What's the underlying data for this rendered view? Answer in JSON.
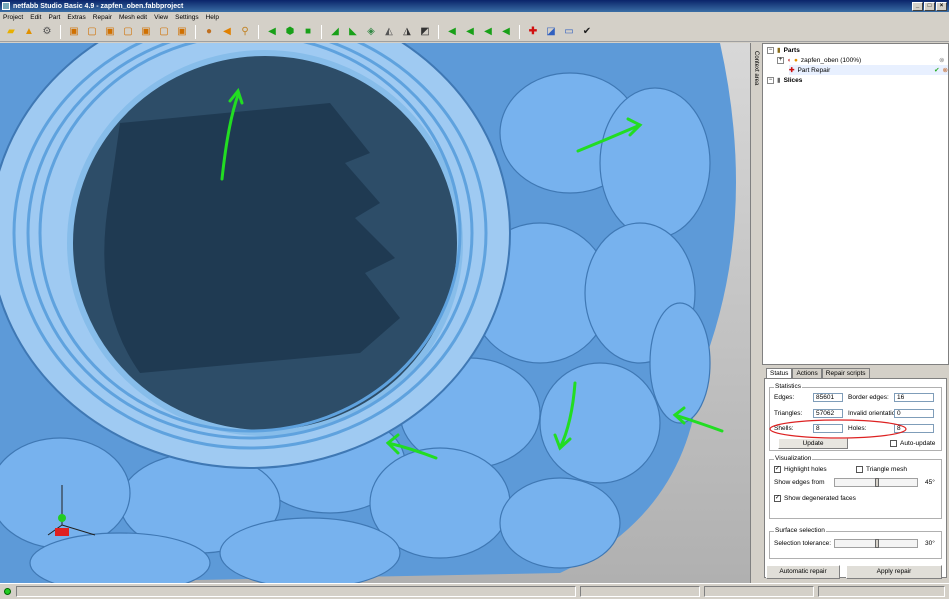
{
  "window": {
    "title": "netfabb Studio Basic 4.9 - zapfen_oben.fabbproject"
  },
  "menu": [
    "Project",
    "Edit",
    "Part",
    "Extras",
    "Repair",
    "Mesh edit",
    "View",
    "Settings",
    "Help"
  ],
  "side_tab": {
    "label": "Context area"
  },
  "tree": {
    "parts_label": "Parts",
    "part_name": "zapfen_oben (100%)",
    "repair_label": "Part Repair",
    "slices_label": "Slices"
  },
  "tabs": [
    "Status",
    "Actions",
    "Repair scripts"
  ],
  "statistics": {
    "title": "Statistics",
    "edges_label": "Edges:",
    "edges_value": "85601",
    "border_edges_label": "Border edges:",
    "border_edges_value": "16",
    "triangles_label": "Triangles:",
    "triangles_value": "57062",
    "invalid_orientation_label": "Invalid orientation:",
    "invalid_orientation_value": "0",
    "shells_label": "Shells:",
    "shells_value": "8",
    "holes_label": "Holes:",
    "holes_value": "8",
    "update_label": "Update",
    "auto_update_label": "Auto-update"
  },
  "visualization": {
    "title": "Visualization",
    "highlight_holes_label": "Highlight holes",
    "highlight_holes_checked": true,
    "triangle_mesh_label": "Triangle mesh",
    "triangle_mesh_checked": false,
    "show_edges_label": "Show edges from",
    "show_edges_value": "45°",
    "show_edges_level": 0.5,
    "show_degenerated_label": "Show degenerated faces",
    "show_degenerated_checked": true
  },
  "surface_selection": {
    "title": "Surface selection",
    "tolerance_label": "Selection tolerance:",
    "tolerance_value": "30°",
    "tolerance_level": 0.5
  },
  "actions": {
    "automatic_repair_label": "Automatic repair",
    "apply_repair_label": "Apply repair"
  },
  "colors": {
    "model": "#6fa7e0",
    "annotation": "#22dd22",
    "highlight_circle": "#dd2222",
    "background": "#c4c4c4"
  }
}
